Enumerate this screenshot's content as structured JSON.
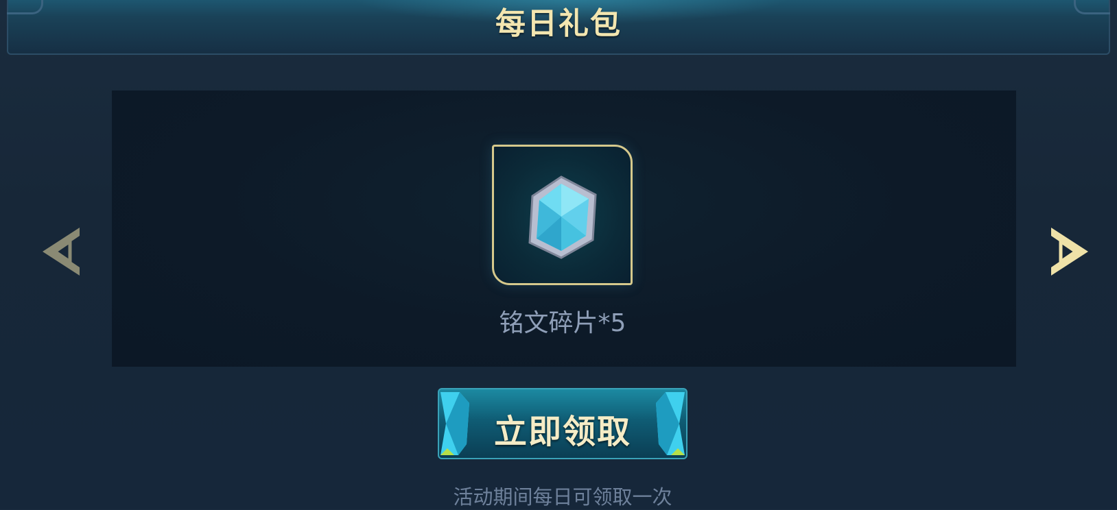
{
  "header": {
    "title": "每日礼包"
  },
  "reward": {
    "item_name": "铭文碎片*5",
    "icon": "crystal-gem-icon"
  },
  "nav": {
    "prev_icon": "chevron-left-icon",
    "next_icon": "chevron-right-icon"
  },
  "action": {
    "claim_label": "立即领取"
  },
  "note": "活动期间每日可领取一次",
  "colors": {
    "title_gold": "#f3e6b0",
    "frame_gold": "#d6c98c",
    "button_teal": "#0f5c74",
    "gem_cyan": "#5cd8f0"
  }
}
